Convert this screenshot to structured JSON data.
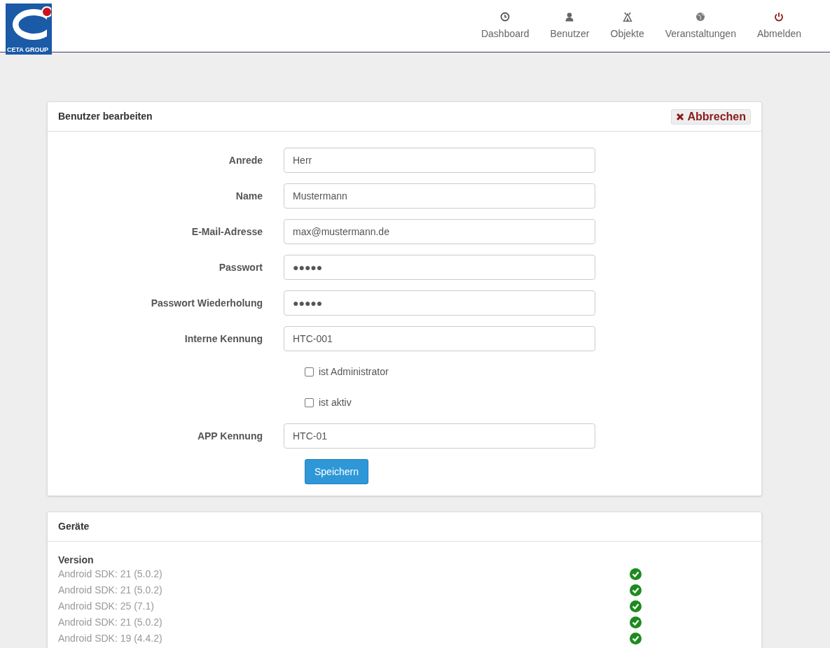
{
  "logo": {
    "text": "CETA GROUP"
  },
  "nav": [
    {
      "label": "Dashboard",
      "kind": "clock"
    },
    {
      "label": "Benutzer",
      "kind": "user"
    },
    {
      "label": "Objekte",
      "kind": "tent"
    },
    {
      "label": "Veranstaltungen",
      "kind": "globe"
    },
    {
      "label": "Abmelden",
      "kind": "power"
    }
  ],
  "edit_panel": {
    "title": "Benutzer bearbeiten",
    "cancel_button": "Abbrechen",
    "fields": [
      {
        "kind": "text",
        "label": "Anrede",
        "value": "Herr"
      },
      {
        "kind": "text",
        "label": "Name",
        "value": "Mustermann"
      },
      {
        "kind": "text",
        "label": "E-Mail-Adresse",
        "value": "max@mustermann.de"
      },
      {
        "kind": "text",
        "label": "Passwort",
        "value": "●●●●●"
      },
      {
        "kind": "text",
        "label": "Passwort Wiederholung",
        "value": "●●●●●"
      },
      {
        "kind": "text",
        "label": "Interne Kennung",
        "value": "HTC-001"
      },
      {
        "kind": "checkbox",
        "label": "ist Administrator",
        "checked": false
      },
      {
        "kind": "checkbox",
        "label": "ist aktiv",
        "checked": false
      },
      {
        "kind": "text",
        "label": "APP Kennung",
        "value": "HTC-01"
      }
    ],
    "save_button": "Speichern"
  },
  "devices_panel": {
    "title": "Geräte",
    "column_header": "Version",
    "rows": [
      {
        "version": "Android SDK: 21 (5.0.2)",
        "ok": true
      },
      {
        "version": "Android SDK: 21 (5.0.2)",
        "ok": true
      },
      {
        "version": "Android SDK: 25 (7.1)",
        "ok": true
      },
      {
        "version": "Android SDK: 21 (5.0.2)",
        "ok": true
      },
      {
        "version": "Android SDK: 19 (4.4.2)",
        "ok": true
      }
    ]
  }
}
